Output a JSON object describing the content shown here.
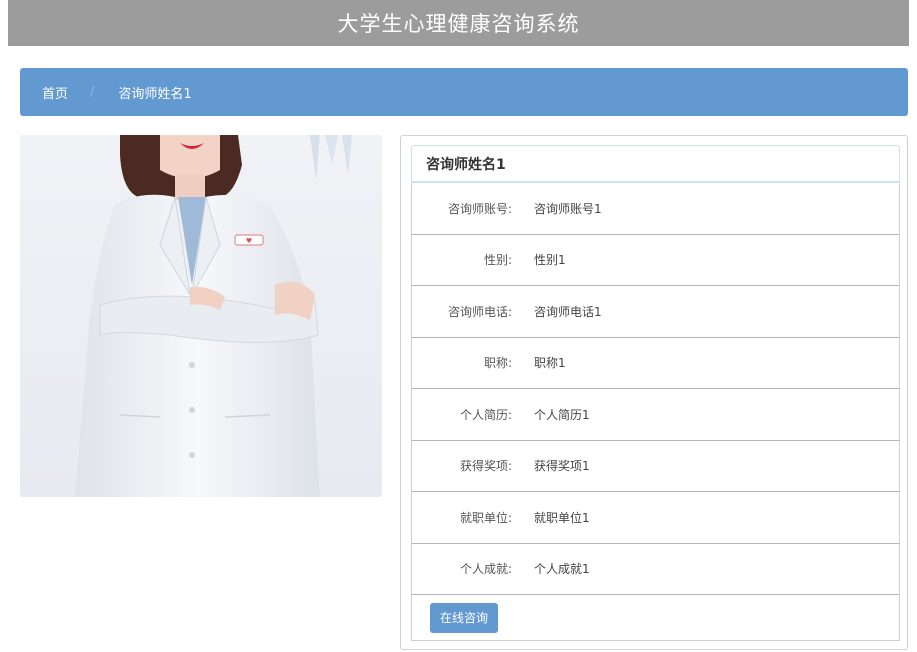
{
  "header": {
    "title": "大学生心理健康咨询系统"
  },
  "breadcrumb": {
    "home": "首页",
    "current": "咨询师姓名1"
  },
  "detail": {
    "name": "咨询师姓名1",
    "rows": [
      {
        "label": "咨询师账号:",
        "value": "咨询师账号1"
      },
      {
        "label": "性别:",
        "value": "性别1"
      },
      {
        "label": "咨询师电话:",
        "value": "咨询师电话1"
      },
      {
        "label": "职称:",
        "value": "职称1"
      },
      {
        "label": "个人简历:",
        "value": "个人简历1"
      },
      {
        "label": "获得奖项:",
        "value": "获得奖项1"
      },
      {
        "label": "就职单位:",
        "value": "就职单位1"
      },
      {
        "label": "个人成就:",
        "value": "个人成就1"
      }
    ],
    "consult_button": "在线咨询"
  },
  "colors": {
    "header_bg": "#9c9c9c",
    "accent": "#6299d0"
  }
}
